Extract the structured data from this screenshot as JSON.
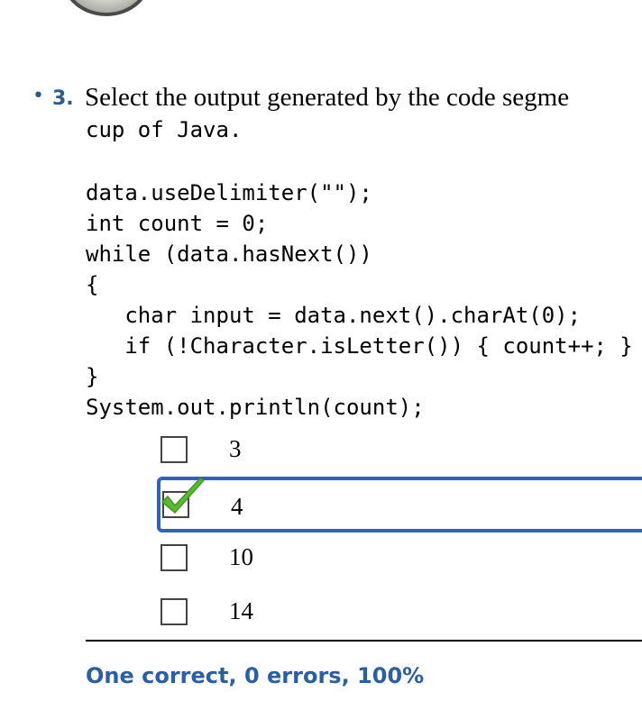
{
  "question": {
    "number": "3.",
    "text": "Select the output generated by the code segme",
    "text_line2": "cup of Java.",
    "code": "data.useDelimiter(\"\");\nint count = 0;\nwhile (data.hasNext())\n{\n   char input = data.next().charAt(0);\n   if (!Character.isLetter()) { count++; }\n}\nSystem.out.println(count);"
  },
  "options": [
    {
      "label": "3",
      "checked": false
    },
    {
      "label": "4",
      "checked": true
    },
    {
      "label": "10",
      "checked": false
    },
    {
      "label": "14",
      "checked": false
    }
  ],
  "result": "One correct, 0 errors, 100%",
  "colors": {
    "accent": "#2f62c0",
    "result": "#2a5fa8",
    "check": "#5cb832"
  }
}
